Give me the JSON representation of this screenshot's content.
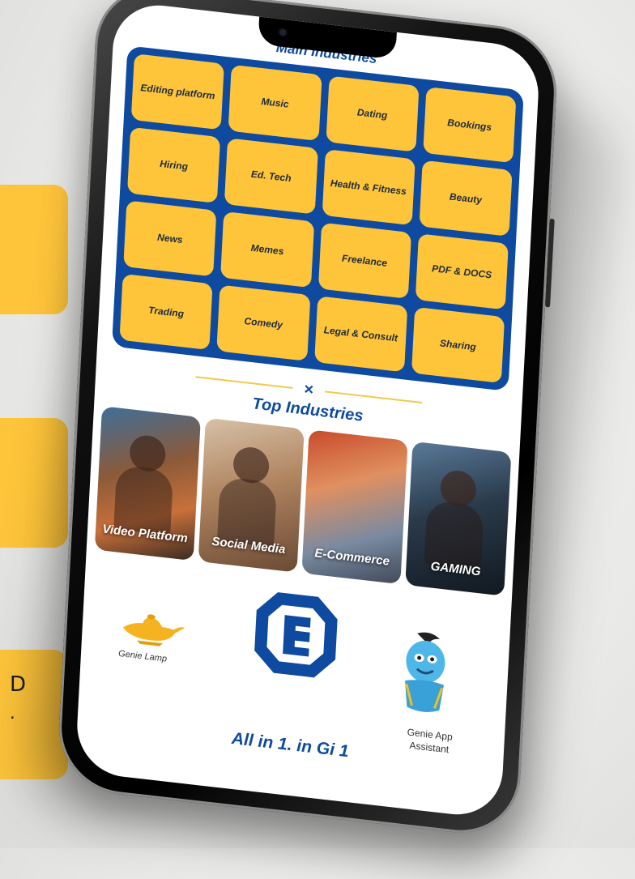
{
  "side_cards": [
    {
      "text": "",
      "text2": ""
    },
    {
      "text": "",
      "text2": ""
    },
    {
      "text": "D",
      "text2": "."
    }
  ],
  "main_industries": {
    "title": "Main Industries",
    "tiles": [
      "Editing platform",
      "Music",
      "Dating",
      "Bookings",
      "Hiring",
      "Ed. Tech",
      "Health & Fitness",
      "Beauty",
      "News",
      "Memes",
      "Freelance",
      "PDF & DOCS",
      "Trading",
      "Comedy",
      "Legal & Consult",
      "Sharing"
    ]
  },
  "divider": {
    "symbol": "×"
  },
  "top_industries": {
    "title": "Top Industries",
    "cards": [
      {
        "label": "Video Platform"
      },
      {
        "label": "Social Media"
      },
      {
        "label": "E-Commerce"
      },
      {
        "label": "GAMING"
      }
    ]
  },
  "genie_lamp": {
    "label": "Genie Lamp"
  },
  "genie_assistant": {
    "label": "Genie App Assistant"
  },
  "slogan": "All in 1. in Gi 1",
  "colors": {
    "accent": "#0d4aa0",
    "tile": "#fec43a"
  }
}
